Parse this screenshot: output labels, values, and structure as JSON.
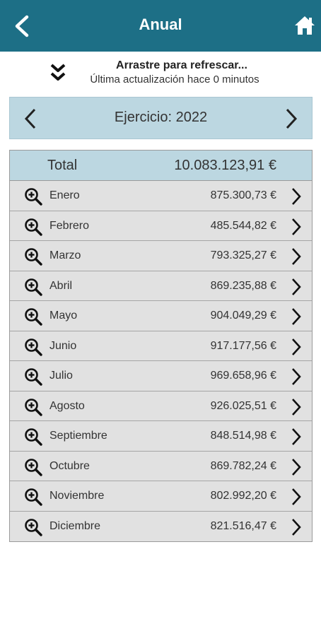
{
  "header": {
    "title": "Anual",
    "back_icon": "back-arrow-icon",
    "home_icon": "home-icon",
    "bg_color": "#1d6f86"
  },
  "refresh": {
    "line1": "Arrastre para refrescar...",
    "line2": "Última actualización hace 0 minutos",
    "icon": "double-chevron-down-icon"
  },
  "year": {
    "label": "Ejercicio: 2022",
    "prev_icon": "chevron-left-icon",
    "next_icon": "chevron-right-icon"
  },
  "totals": {
    "label": "Total",
    "value": "10.083.123,91 €"
  },
  "months": [
    {
      "name": "Enero",
      "value": "875.300,73 €"
    },
    {
      "name": "Febrero",
      "value": "485.544,82 €"
    },
    {
      "name": "Marzo",
      "value": "793.325,27 €"
    },
    {
      "name": "Abril",
      "value": "869.235,88 €"
    },
    {
      "name": "Mayo",
      "value": "904.049,29 €"
    },
    {
      "name": "Junio",
      "value": "917.177,56 €"
    },
    {
      "name": "Julio",
      "value": "969.658,96 €"
    },
    {
      "name": "Agosto",
      "value": "926.025,51 €"
    },
    {
      "name": "Septiembre",
      "value": "848.514,98 €"
    },
    {
      "name": "Octubre",
      "value": "869.782,24 €"
    },
    {
      "name": "Noviembre",
      "value": "802.992,20 €"
    },
    {
      "name": "Diciembre",
      "value": "821.516,47 €"
    }
  ]
}
